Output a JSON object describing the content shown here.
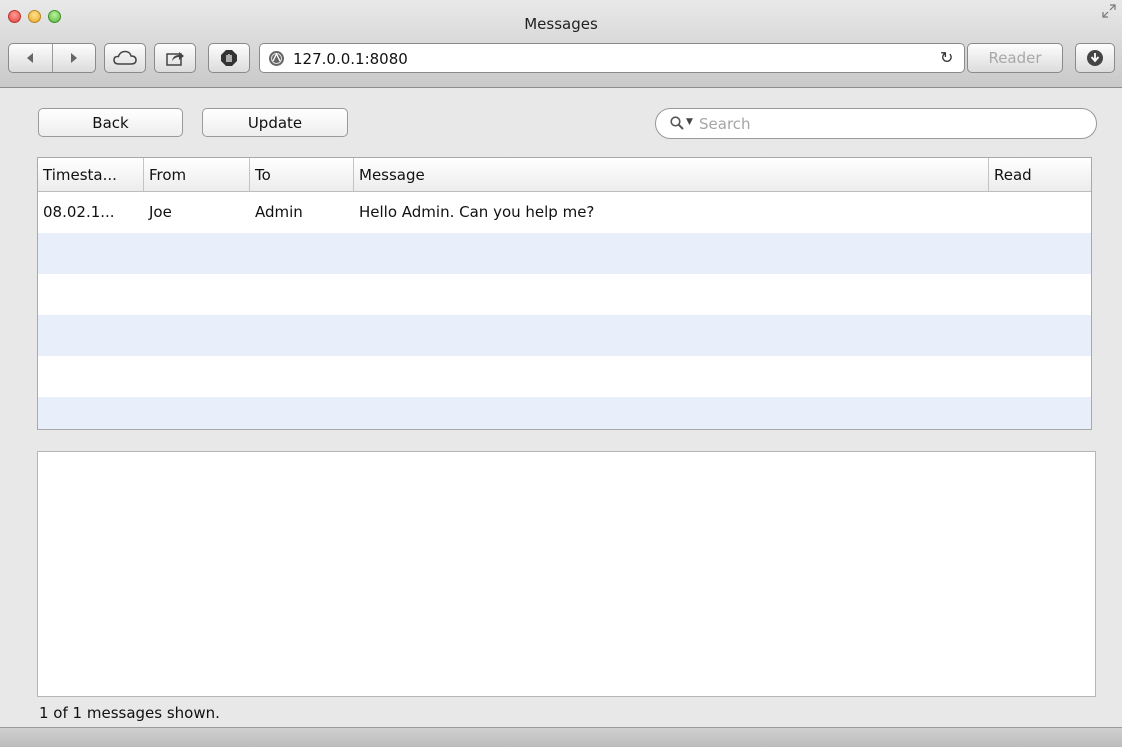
{
  "window": {
    "title": "Messages"
  },
  "toolbar": {
    "address": "127.0.0.1:8080",
    "reader_label": "Reader"
  },
  "actions": {
    "back_label": "Back",
    "update_label": "Update"
  },
  "search": {
    "placeholder": "Search"
  },
  "table": {
    "columns": [
      "Timesta...",
      "From",
      "To",
      "Message",
      "Read"
    ],
    "rows": [
      [
        "08.02.1...",
        "Joe",
        "Admin",
        "Hello Admin. Can you help me?",
        ""
      ],
      [
        "",
        "",
        "",
        "",
        ""
      ],
      [
        "",
        "",
        "",
        "",
        ""
      ],
      [
        "",
        "",
        "",
        "",
        ""
      ],
      [
        "",
        "",
        "",
        "",
        ""
      ],
      [
        "",
        "",
        "",
        "",
        ""
      ]
    ]
  },
  "status": {
    "text": "1 of 1 messages shown."
  },
  "icons": [
    "back-arrow-icon",
    "forward-arrow-icon",
    "icloud-icon",
    "share-icon",
    "block-icon",
    "site-icon",
    "reload-icon",
    "download-icon",
    "search-icon",
    "fullscreen-icon"
  ]
}
